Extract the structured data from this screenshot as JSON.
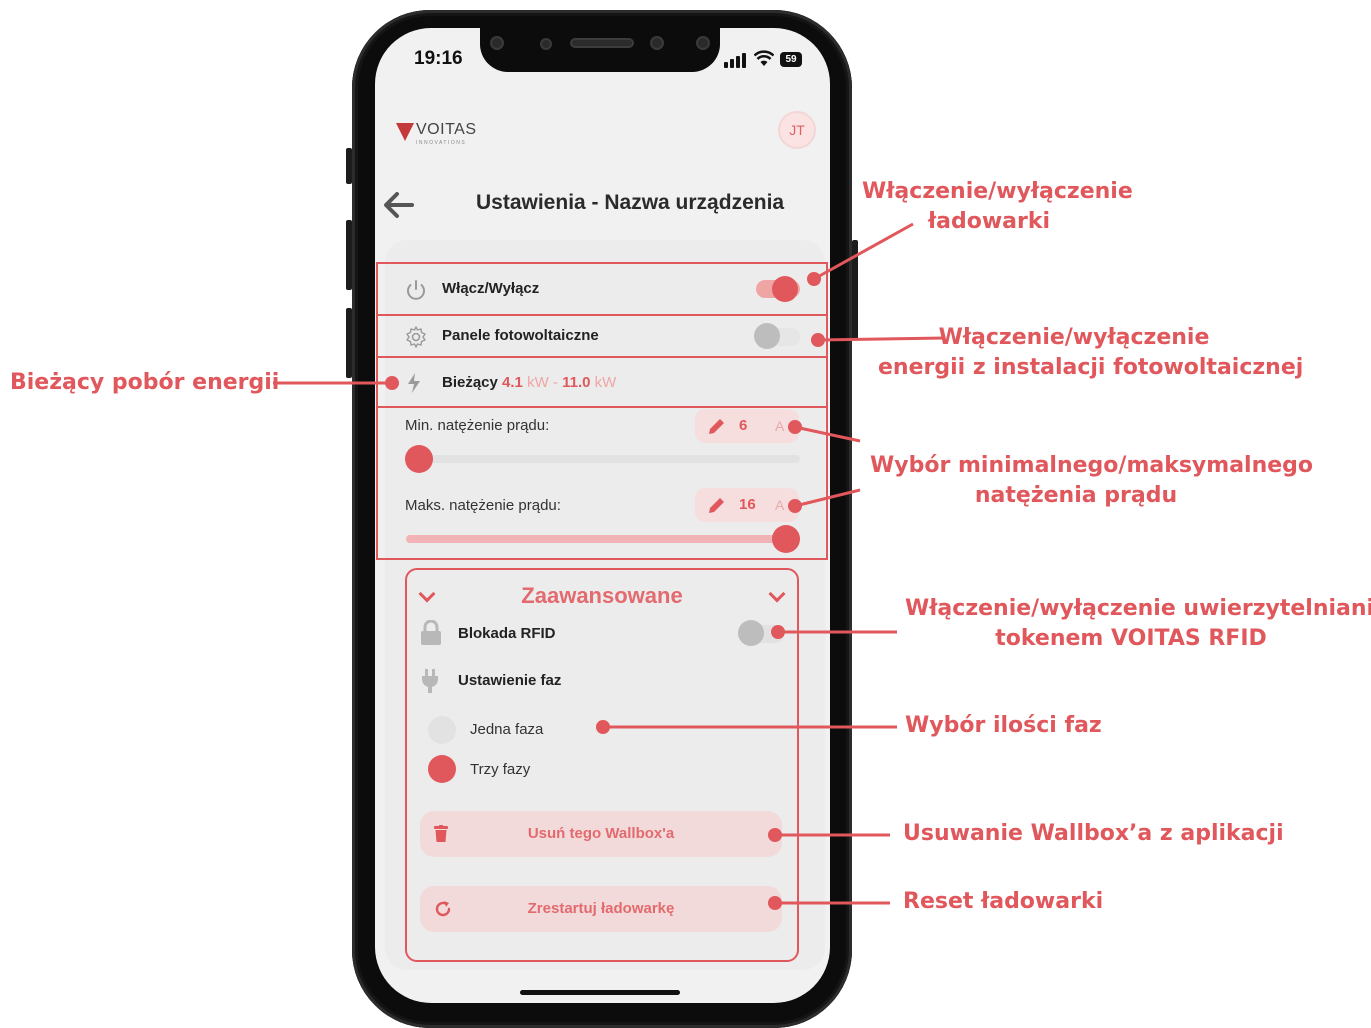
{
  "status_bar": {
    "time": "19:16",
    "battery": "59"
  },
  "header": {
    "logo_text": "VOITAS",
    "logo_sub": "INNOVATIONS",
    "avatar": "JT",
    "title": "Ustawienia - Nazwa urządzenia"
  },
  "settings": {
    "power_toggle": {
      "label": "Włącz/Wyłącz",
      "on": true
    },
    "pv_toggle": {
      "label": "Panele fotowoltaiczne",
      "on": false
    },
    "power": {
      "label": "Bieżący",
      "value_min": "4.1",
      "unit_min": "kW",
      "separator": "-",
      "value_max": "11.0",
      "unit_max": "kW"
    },
    "min_current": {
      "label": "Min. natężenie prądu:",
      "value": "6",
      "unit": "A",
      "slider_level": 0.0
    },
    "max_current": {
      "label": "Maks. natężenie prądu:",
      "value": "16",
      "unit": "A",
      "slider_level": 1.0
    }
  },
  "advanced": {
    "title": "Zaawansowane",
    "rfid": {
      "label": "Blokada RFID",
      "on": false
    },
    "phases": {
      "label": "Ustawienie faz",
      "options": [
        {
          "label": "Jedna faza",
          "selected": false
        },
        {
          "label": "Trzy fazy",
          "selected": true
        }
      ]
    },
    "delete_button": "Usuń tego Wallbox'a",
    "restart_button": "Zrestartuj ładowarkę"
  },
  "annotations": {
    "charger_toggle": [
      "Włączenie/wyłączenie",
      "ładowarki"
    ],
    "pv_energy": [
      "Włączenie/wyłączenie",
      "energii z instalacji fotowoltaicznej"
    ],
    "current_power": "Bieżący pobór energii",
    "current_select": [
      "Wybór minimalnego/maksymalnego",
      "natężenia prądu"
    ],
    "rfid_auth": [
      "Włączenie/wyłączenie uwierzytelniania",
      "tokenem VOITAS RFID"
    ],
    "phase_select": "Wybór ilości faz",
    "delete_wallbox": "Usuwanie Wallbox’a z aplikacji",
    "reset_charger": "Reset ładowarki"
  },
  "colors": {
    "accent": "#e0575c",
    "accent_light": "#f1b3b5",
    "toggle_off": "#bdbdbd",
    "screen_bg": "#f1f1f1"
  }
}
